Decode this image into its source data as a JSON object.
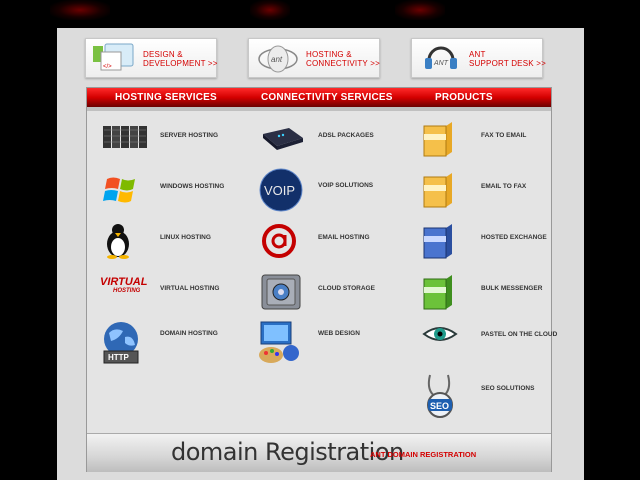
{
  "top_buttons": [
    {
      "line1": "DESIGN  &",
      "line2": "DEVELOPMENT >>",
      "icon": "design-icon"
    },
    {
      "line1": "HOSTING  &",
      "line2": "CONNECTIVITY >>",
      "icon": "hosting-icon"
    },
    {
      "line1": "ANT",
      "line2": "SUPPORT DESK >>",
      "icon": "support-icon"
    }
  ],
  "headers": {
    "hosting": "HOSTING SERVICES",
    "connectivity": "CONNECTIVITY SERVICES",
    "products": "PRODUCTS"
  },
  "hosting": [
    {
      "label": "SERVER HOSTING",
      "icon": "server-rack-icon"
    },
    {
      "label": "WINDOWS HOSTING",
      "icon": "windows-logo-icon"
    },
    {
      "label": "LINUX HOSTING",
      "icon": "linux-penguin-icon"
    },
    {
      "label": "VIRTUAL HOSTING",
      "icon": "virtual-hosting-icon",
      "icon_text1": "VIRTUAL",
      "icon_text2": "HOSTING"
    },
    {
      "label": "DOMAIN HOSTING",
      "icon": "http-globe-icon",
      "icon_text1": "HTTP"
    }
  ],
  "connectivity": [
    {
      "label": "ADSL PACKAGES",
      "icon": "adsl-modem-icon"
    },
    {
      "label": "VOIP SOLUTIONS",
      "icon": "voip-globe-icon",
      "icon_text1": "VOIP"
    },
    {
      "label": "EMAIL HOSTING",
      "icon": "at-sign-icon"
    },
    {
      "label": "CLOUD STORAGE",
      "icon": "safe-icon"
    },
    {
      "label": "WEB DESIGN",
      "icon": "web-design-icon"
    }
  ],
  "products": [
    {
      "label": "FAX TO EMAIL",
      "icon": "software-box-icon"
    },
    {
      "label": "EMAIL TO FAX",
      "icon": "software-box-icon"
    },
    {
      "label": "HOSTED EXCHANGE",
      "icon": "software-box-icon"
    },
    {
      "label": "BULK MESSENGER",
      "icon": "software-box-icon"
    },
    {
      "label": "PASTEL ON THE CLOUD",
      "icon": "eye-icon"
    },
    {
      "label": "SEO SOLUTIONS",
      "icon": "seo-stethoscope-icon",
      "icon_text1": "SEO"
    }
  ],
  "domain_bar": {
    "logo_text": "domain Registration",
    "link": "ANT DOMAIN REGISTRATION"
  },
  "colors": {
    "accent": "#d40000",
    "header_dark": "#6a0000",
    "page_bg": "#dcdcdc",
    "panel_bg": "#e4e4e4"
  }
}
